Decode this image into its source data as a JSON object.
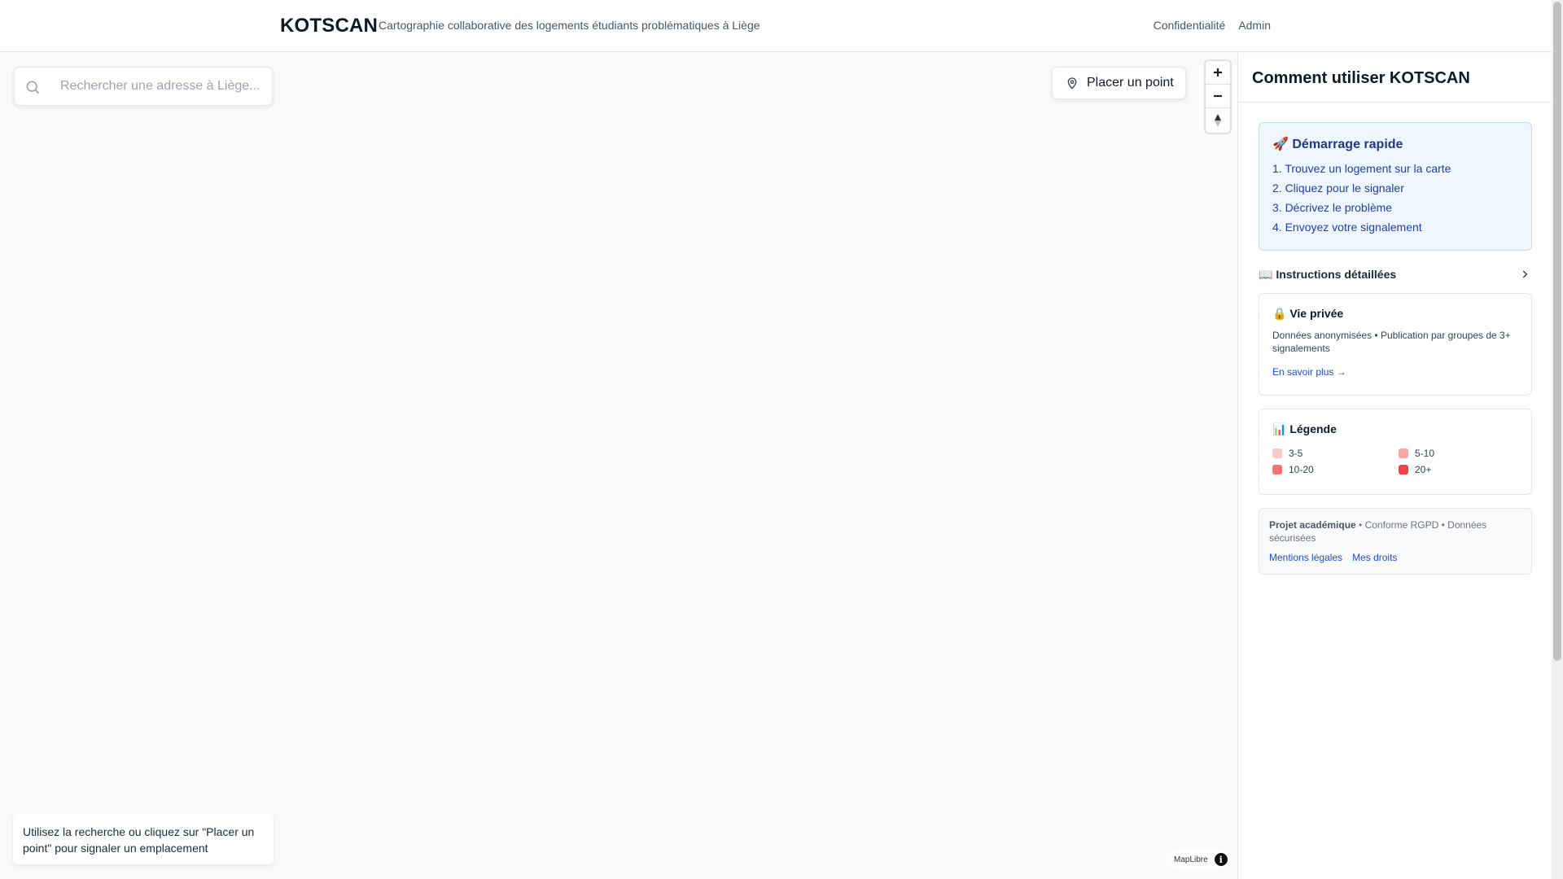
{
  "header": {
    "brand": "KOTSCAN",
    "tagline": "Cartographie collaborative des logements étudiants problématiques à Liège",
    "nav": [
      "Confidentialité",
      "Admin"
    ]
  },
  "map": {
    "search_placeholder": "Rechercher une adresse à Liège...",
    "place_point_label": "Placer un point",
    "zoom_in": "+",
    "zoom_out": "−",
    "hint": "Utilisez la recherche ou cliquez sur \"Placer un point\" pour signaler un emplacement",
    "attribution": "MapLibre",
    "attribution_icon": "i"
  },
  "sidebar": {
    "title": "Comment utiliser KOTSCAN",
    "quick_start": {
      "title": "🚀 Démarrage rapide",
      "steps": [
        "1. Trouvez un logement sur la carte",
        "2. Cliquez pour le signaler",
        "3. Décrivez le problème",
        "4. Envoyez votre signalement"
      ]
    },
    "instructions_label": "📖 Instructions détaillées",
    "privacy": {
      "title": "🔒 Vie privée",
      "text": "Données anonymisées • Publication par groupes de 3+ signalements",
      "link": "En savoir plus →"
    },
    "legend": {
      "title": "📊 Légende",
      "items": [
        {
          "label": "3-5",
          "color": "#fecaca"
        },
        {
          "label": "5-10",
          "color": "#fca5a5"
        },
        {
          "label": "10-20",
          "color": "#f87171"
        },
        {
          "label": "20+",
          "color": "#ef4444"
        }
      ]
    },
    "footer": {
      "bold": "Projet académique",
      "text": " • Conforme RGPD • Données sécurisées",
      "links": [
        "Mentions légales",
        "Mes droits"
      ]
    }
  },
  "colors": {
    "accent": "#1d4ed8",
    "quick_bg": "#eff6ff",
    "quick_border": "#bfdbfe"
  }
}
